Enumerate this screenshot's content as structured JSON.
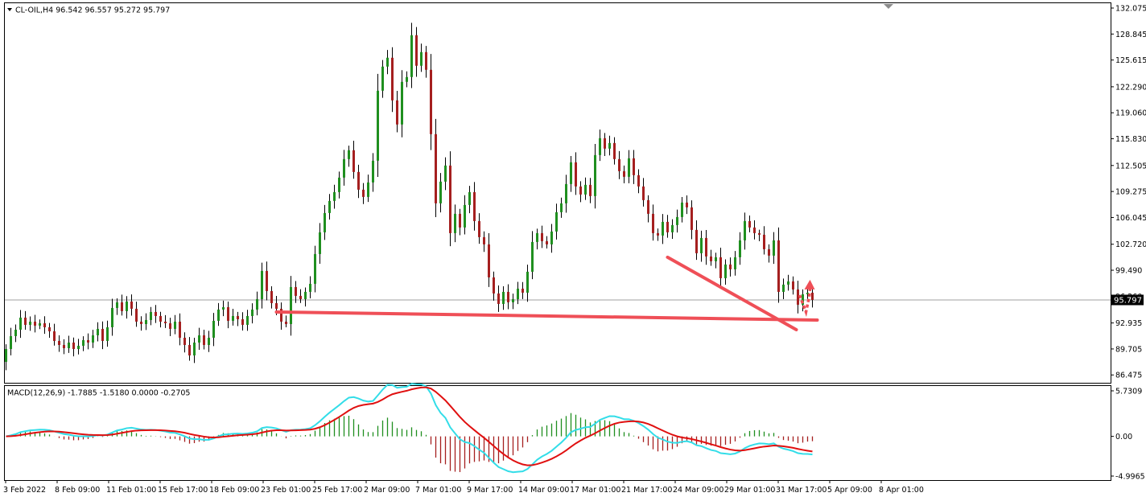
{
  "header": {
    "symbol_line": "CL-OIL,H4  96.542 96.557 95.272 95.797",
    "indicator_line": "MACD(12,26,9) -1.7885 -1.5180 0.0000 -0.2705"
  },
  "colors": {
    "bull": "#1f8f1f",
    "bear": "#a51f1f",
    "wick": "#000000",
    "macd_line": "#33dde8",
    "signal_line": "#e01010",
    "annotation": "#ef4f57",
    "price_tag_bg": "#000000",
    "price_tag_text": "#ffffff"
  },
  "chart_data": {
    "type": "candlestick",
    "price_axis": {
      "ylim": [
        85.8,
        132.075
      ],
      "ticks": [
        "132.075",
        "128.845",
        "125.615",
        "122.290",
        "119.060",
        "115.830",
        "112.505",
        "109.275",
        "106.045",
        "102.720",
        "99.490",
        "96.260",
        "92.935",
        "89.705",
        "86.475"
      ],
      "current_price": "95.797",
      "current_value": 95.797
    },
    "macd_axis": {
      "ylim": [
        -4.9965,
        5.7309
      ],
      "ticks": [
        "5.7309",
        "0.00",
        "-4.9965"
      ]
    },
    "time_axis": {
      "labels": [
        "3 Feb 2022",
        "8 Feb 09:00",
        "11 Feb 01:00",
        "15 Feb 17:00",
        "18 Feb 09:00",
        "23 Feb 01:00",
        "25 Feb 17:00",
        "2 Mar 09:00",
        "7 Mar 01:00",
        "9 Mar 17:00",
        "14 Mar 09:00",
        "17 Mar 01:00",
        "21 Mar 17:00",
        "24 Mar 09:00",
        "29 Mar 01:00",
        "31 Mar 17:00",
        "5 Apr 09:00",
        "8 Apr 01:00"
      ]
    },
    "closes": [
      89.7,
      91.3,
      92.1,
      93.6,
      92.7,
      93.1,
      92.6,
      92.9,
      92.4,
      91.9,
      90.7,
      90.2,
      89.8,
      90.5,
      89.7,
      90.1,
      90.8,
      90.5,
      91.4,
      92.2,
      90.7,
      92.4,
      94.8,
      95.5,
      94.4,
      95.6,
      94.7,
      93.1,
      92.8,
      93.3,
      94.3,
      93.8,
      93.1,
      92.9,
      92.2,
      93.1,
      91.1,
      90.2,
      88.9,
      90.5,
      91.4,
      90.2,
      91.1,
      93.2,
      94.6,
      94.9,
      93.2,
      93.8,
      93.4,
      92.7,
      93.8,
      94.6,
      95.9,
      99.4,
      96.9,
      95.4,
      94.7,
      93.1,
      92.8,
      97.4,
      96.3,
      95.9,
      96.8,
      97.8,
      101.5,
      104.2,
      106.6,
      108.1,
      109.2,
      111.0,
      113.3,
      114.4,
      111.7,
      109.5,
      108.6,
      110.4,
      113.1,
      121.8,
      124.8,
      125.9,
      120.6,
      117.6,
      122.9,
      123.5,
      128.7,
      124.9,
      126.6,
      124.4,
      116.4,
      107.8,
      110.5,
      112.5,
      104.1,
      106.5,
      104.8,
      107.6,
      109.2,
      105.6,
      103.6,
      102.7,
      98.6,
      96.6,
      95.3,
      96.8,
      95.5,
      95.9,
      97.2,
      96.7,
      99.3,
      103.0,
      104.1,
      103.1,
      102.7,
      104.3,
      106.7,
      107.8,
      110.2,
      112.9,
      109.9,
      108.9,
      110.1,
      108.7,
      113.8,
      115.9,
      114.6,
      115.3,
      113.3,
      111.8,
      111.1,
      113.4,
      111.3,
      109.9,
      108.2,
      106.5,
      104.1,
      103.8,
      105.5,
      104.2,
      105.1,
      106.1,
      107.9,
      107.3,
      104.5,
      101.6,
      103.5,
      101.2,
      100.6,
      101.1,
      98.5,
      100.2,
      99.6,
      101.1,
      103.2,
      105.6,
      104.8,
      104.1,
      103.9,
      102.1,
      101.3,
      103.2,
      96.8,
      97.7,
      98.1,
      97.1,
      95.2,
      96.5,
      96.7,
      95.797
    ],
    "annotations": {
      "support_line": {
        "from": [
          56,
          94.3
        ],
        "to": [
          167,
          93.3
        ]
      },
      "falling_line": {
        "from": [
          137,
          101.1
        ],
        "to": [
          163,
          92.1
        ]
      },
      "up_arrow_note": "dotted red arrow pointing upward from the last candles"
    }
  }
}
